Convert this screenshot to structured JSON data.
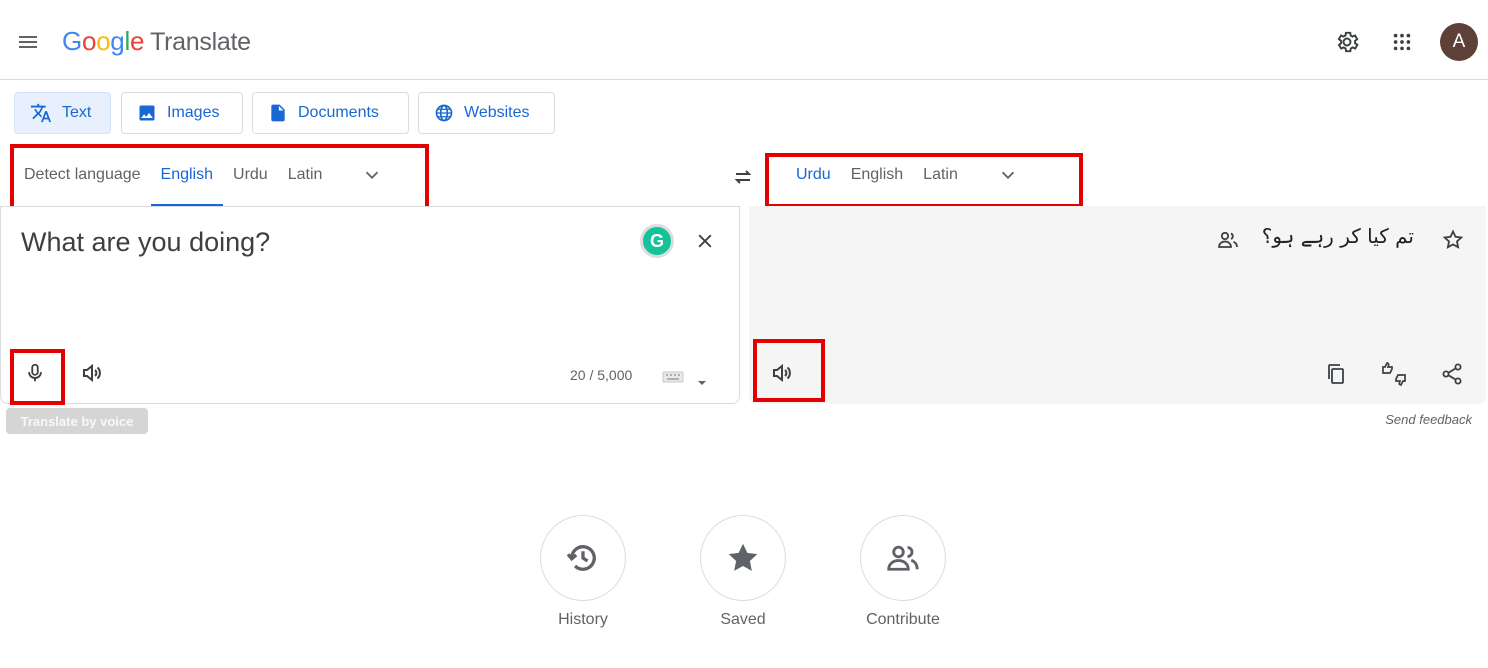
{
  "header": {
    "logo_letters": [
      "G",
      "o",
      "o",
      "g",
      "l",
      "e"
    ],
    "product": "Translate",
    "avatar_initial": "A"
  },
  "mode_tabs": [
    {
      "label": "Text",
      "icon": "translate-icon"
    },
    {
      "label": "Images",
      "icon": "image-icon"
    },
    {
      "label": "Documents",
      "icon": "document-icon"
    },
    {
      "label": "Websites",
      "icon": "globe-icon"
    }
  ],
  "source_languages": [
    "Detect language",
    "English",
    "Urdu",
    "Latin"
  ],
  "target_languages": [
    "Urdu",
    "English",
    "Latin"
  ],
  "source": {
    "text": "What are you doing?",
    "char_count": "20 / 5,000",
    "tooltip": "Translate by voice"
  },
  "target": {
    "text": "تم کیا کر رہے ہو؟",
    "feedback": "Send feedback"
  },
  "bottom_actions": [
    {
      "label": "History",
      "icon": "history-icon"
    },
    {
      "label": "Saved",
      "icon": "star-icon"
    },
    {
      "label": "Contribute",
      "icon": "people-icon"
    }
  ],
  "colors": {
    "accent": "#1967d2",
    "highlight_box": "#e50000",
    "target_bg": "#f5f5f5"
  }
}
